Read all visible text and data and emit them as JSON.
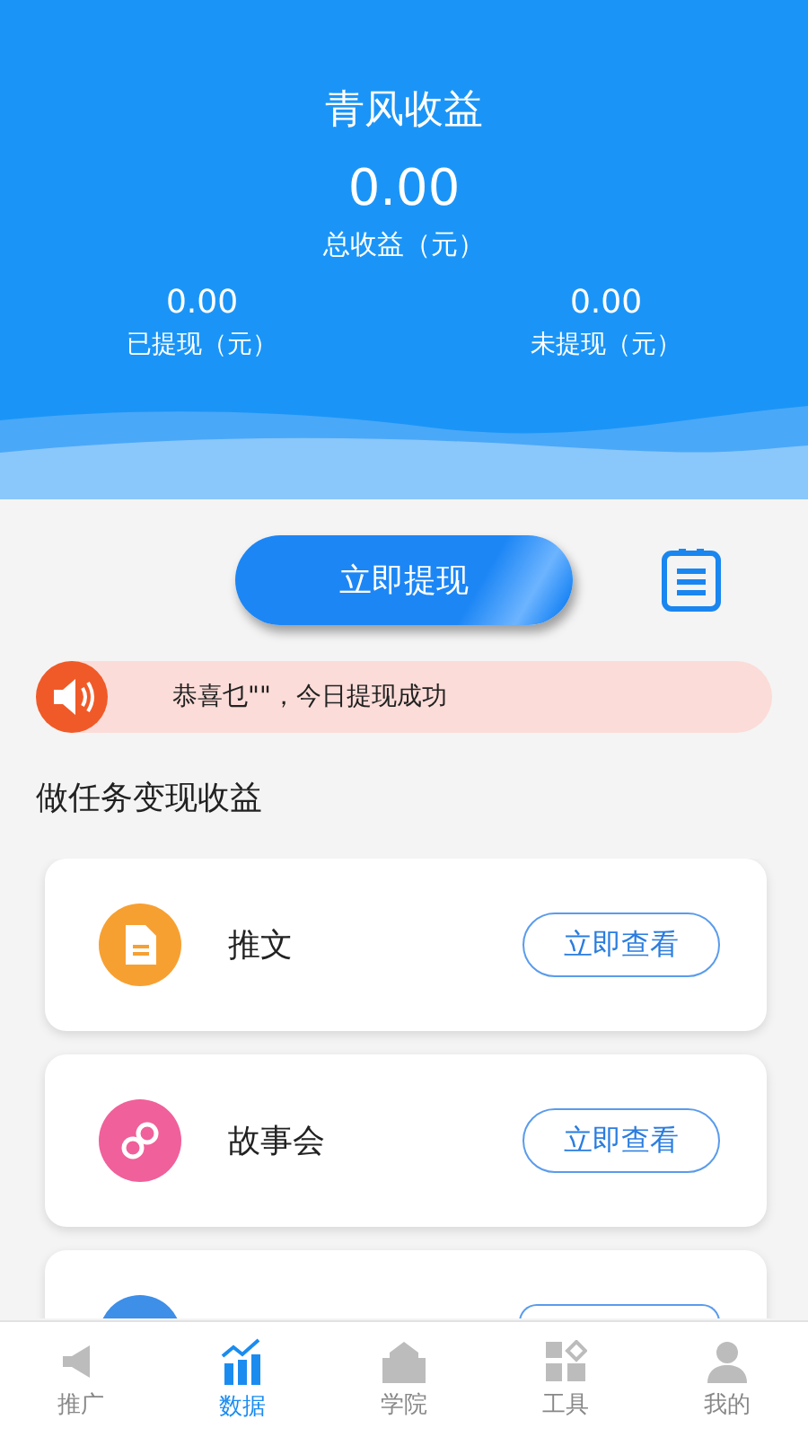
{
  "header": {
    "title": "青风收益",
    "total": {
      "value": "0.00",
      "label": "总收益（元）"
    },
    "stats": [
      {
        "value": "0.00",
        "label": "已提现（元）"
      },
      {
        "value": "0.00",
        "label": "未提现（元）"
      }
    ]
  },
  "withdraw_button": "立即提现",
  "notice": {
    "text": "恭喜乜\"\"，今日提现成功"
  },
  "section_title": "做任务变现收益",
  "tasks": [
    {
      "kind": "article",
      "title": "推文",
      "button": "立即查看",
      "color": "#f7a032"
    },
    {
      "kind": "story",
      "title": "故事会",
      "button": "立即查看",
      "color": "#f0609a"
    },
    {
      "kind": "partial",
      "color": "#3d8fe8"
    }
  ],
  "tabs": [
    {
      "kind": "megaphone",
      "label": "推广",
      "selected": false
    },
    {
      "kind": "chart",
      "label": "数据",
      "selected": true
    },
    {
      "kind": "school",
      "label": "学院",
      "selected": false
    },
    {
      "kind": "tools",
      "label": "工具",
      "selected": false
    },
    {
      "kind": "person",
      "label": "我的",
      "selected": false
    }
  ]
}
